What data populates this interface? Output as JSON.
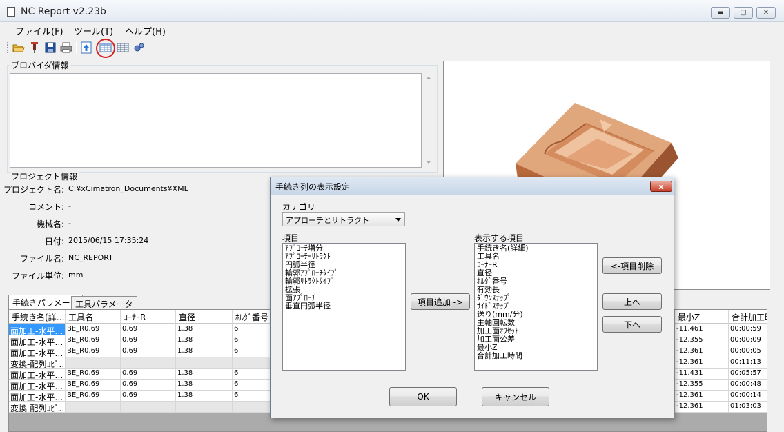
{
  "window": {
    "title": "NC Report v2.23b",
    "controls": {
      "minimize": "▬",
      "maximize": "▢",
      "close": "✕"
    }
  },
  "menu": [
    "ファイル(F)",
    "ツール(T)",
    "ヘルプ(H)"
  ],
  "toolbar": {
    "icons": [
      "open-folder-icon",
      "pin-icon",
      "save-icon",
      "print-icon",
      "export-icon",
      "column-settings-icon",
      "table-icon",
      "settings-icon"
    ],
    "highlighted": "column-settings-icon"
  },
  "provider": {
    "label": "プロバイダ情報",
    "text": ""
  },
  "project": {
    "label": "プロジェクト情報",
    "fields": [
      {
        "key": "プロジェクト名:",
        "value": "C:¥xCimatron_Documents¥XML"
      },
      {
        "key": "コメント:",
        "value": "-"
      },
      {
        "key": "機械名:",
        "value": "-"
      },
      {
        "key": "日付:",
        "value": "2015/06/15 17:35:24"
      },
      {
        "key": "ファイル名:",
        "value": "NC_REPORT"
      },
      {
        "key": "ファイル単位:",
        "value": "mm"
      }
    ]
  },
  "tabs": [
    {
      "label": "手続きパラメータ",
      "active": true
    },
    {
      "label": "工具パラメータ",
      "active": false
    }
  ],
  "grid": {
    "headers_left": [
      "手続き名(詳…",
      "工具名",
      "ｺｰﾅｰR",
      "直径",
      "ﾎﾙﾀﾞ番号"
    ],
    "headers_right": [
      "最小Z",
      "合計加工時"
    ],
    "rows": [
      {
        "name": "面加工-水平…",
        "tool": "BE_R0.69",
        "corner": "0.69",
        "dia": "1.38",
        "holder": "6",
        "minz": "-11.461",
        "time": "00:00:59",
        "kind": "normal"
      },
      {
        "name": "面加工-水平…",
        "tool": "BE_R0.69",
        "corner": "0.69",
        "dia": "1.38",
        "holder": "6",
        "minz": "-12.355",
        "time": "00:00:09",
        "kind": "normal"
      },
      {
        "name": "面加工-水平…",
        "tool": "BE_R0.69",
        "corner": "0.69",
        "dia": "1.38",
        "holder": "6",
        "minz": "-12.361",
        "time": "00:00:05",
        "kind": "normal"
      },
      {
        "name": "変換-配列ｺﾋﾟ…",
        "tool": "",
        "corner": "",
        "dia": "",
        "holder": "",
        "minz": "-12.361",
        "time": "00:11:13",
        "kind": "gray"
      },
      {
        "name": "面加工-水平…",
        "tool": "BE_R0.69",
        "corner": "0.69",
        "dia": "1.38",
        "holder": "6",
        "minz": "-11.431",
        "time": "00:05:57",
        "kind": "normal"
      },
      {
        "name": "面加工-水平…",
        "tool": "BE_R0.69",
        "corner": "0.69",
        "dia": "1.38",
        "holder": "6",
        "minz": "-12.355",
        "time": "00:00:48",
        "kind": "normal"
      },
      {
        "name": "面加工-水平…",
        "tool": "BE_R0.69",
        "corner": "0.69",
        "dia": "1.38",
        "holder": "6",
        "minz": "-12.361",
        "time": "00:00:14",
        "kind": "normal"
      },
      {
        "name": "変換-配列ｺﾋﾟ…",
        "tool": "",
        "corner": "",
        "dia": "",
        "holder": "",
        "minz": "-12.361",
        "time": "01:03:03",
        "kind": "gray"
      }
    ]
  },
  "dialog": {
    "title": "手続き列の表示設定",
    "close": "x",
    "category_label": "カテゴリ",
    "category_value": "アプローチとリトラクト",
    "items_label": "項目",
    "items": [
      "ｱﾌﾟﾛｰﾁ増分",
      "ｱﾌﾟﾛｰﾁｰﾘﾄﾗｸﾄ",
      "円弧半径",
      "輪郭ｱﾌﾟﾛｰﾁﾀｲﾌﾟ",
      "輪郭ﾘﾄﾗｸﾄﾀｲﾌﾟ",
      "拡張",
      "面ｱﾌﾟﾛｰﾁ",
      "垂直円弧半径"
    ],
    "shown_label": "表示する項目",
    "shown_items": [
      "手続き名(詳細)",
      "工具名",
      "ｺｰﾅｰR",
      "直径",
      "ﾎﾙﾀﾞ番号",
      "有効長",
      "ﾀﾞｳﾝｽﾃｯﾌﾟ",
      "ｻｲﾄﾞｽﾃｯﾌﾟ",
      "送り(mm/分)",
      "主軸回転数",
      "加工面ｵﾌｾｯﾄ",
      "加工面公差",
      "最小Z",
      "合計加工時間"
    ],
    "add_button": "項目追加 ->",
    "remove_button": "<-項目削除",
    "up_button": "上へ",
    "down_button": "下へ",
    "ok_button": "OK",
    "cancel_button": "キャンセル"
  }
}
